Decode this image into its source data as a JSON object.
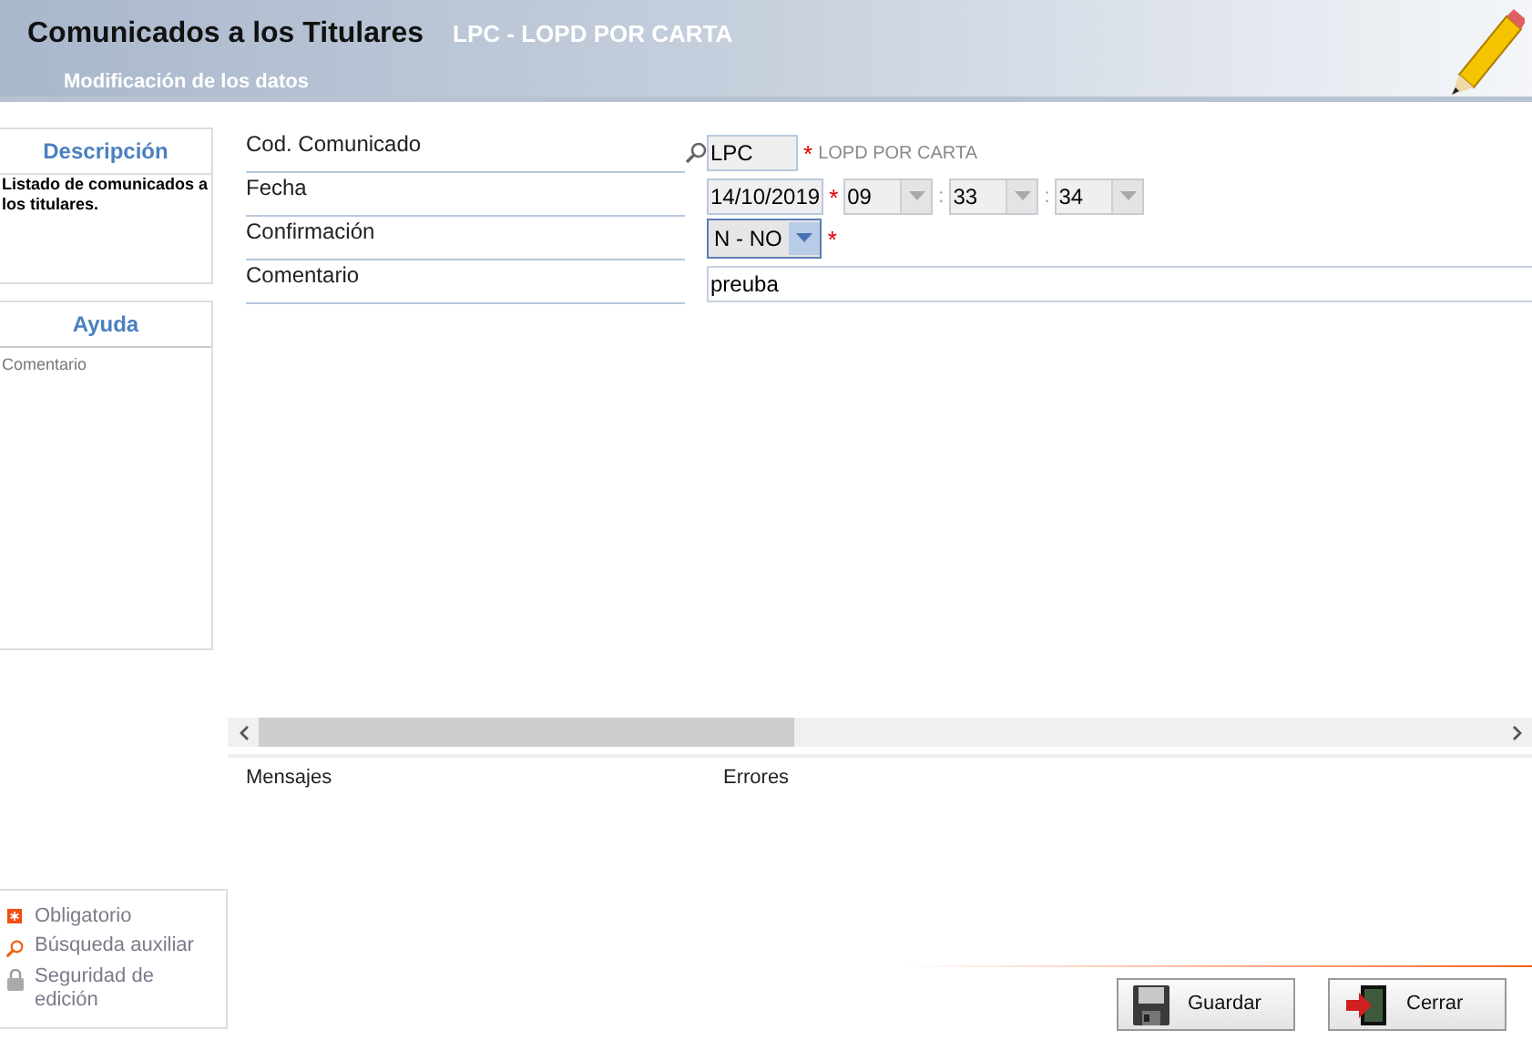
{
  "header": {
    "title": "Comunicados a los Titulares",
    "record": "LPC - LOPD POR CARTA",
    "subtitle": "Modificación de los datos"
  },
  "description": {
    "title": "Descripción",
    "text": "Listado de comunicados a los titulares."
  },
  "help": {
    "title": "Ayuda",
    "text": "Comentario"
  },
  "fields": [
    {
      "kind": "lookup",
      "label": "Cod. Comunicado",
      "value": "LPC",
      "required": true,
      "hint": "LOPD POR CARTA"
    },
    {
      "kind": "datetime",
      "label": "Fecha",
      "value": "14/10/2019",
      "required": true,
      "hour": "09",
      "minute": "33",
      "second": "34",
      "separator": ":"
    },
    {
      "kind": "select",
      "label": "Confirmación",
      "value": "N - NO",
      "required": true
    },
    {
      "kind": "text",
      "label": "Comentario",
      "value": "preuba",
      "required": false
    }
  ],
  "messages": {
    "column_1": "Mensajes",
    "column_2": "Errores"
  },
  "legend": [
    {
      "kind": "required",
      "label": "Obligatorio"
    },
    {
      "kind": "search",
      "label": "Búsqueda auxiliar"
    },
    {
      "kind": "lock",
      "label": "Seguridad de edición"
    }
  ],
  "required_mark": "*",
  "buttons": [
    {
      "kind": "save",
      "label": "Guardar"
    },
    {
      "kind": "close",
      "label": "Cerrar"
    }
  ]
}
